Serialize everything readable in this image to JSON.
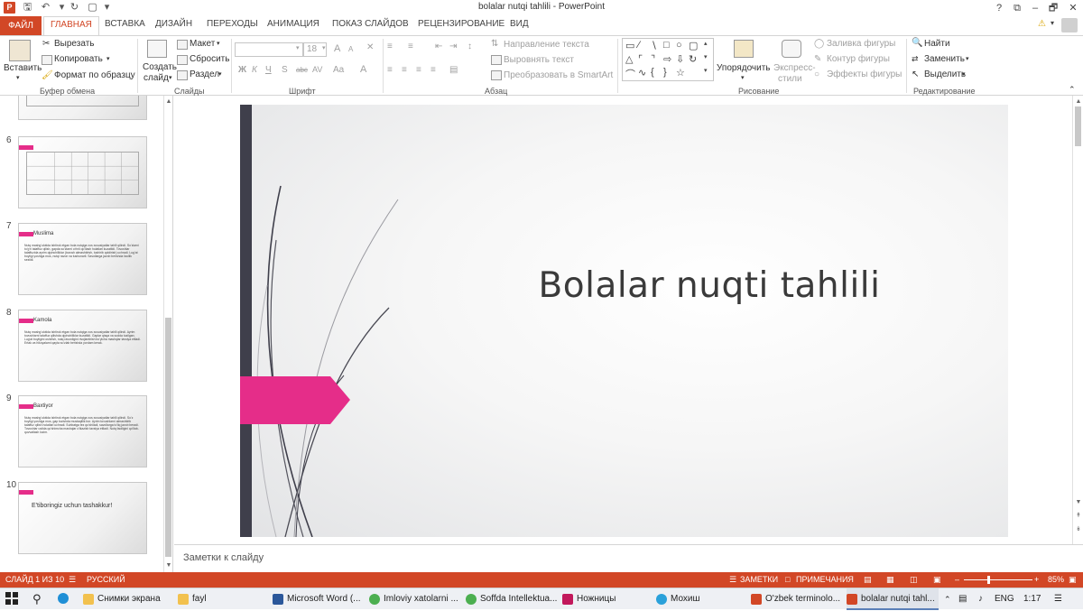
{
  "window": {
    "title": "bolalar nutqi tahlili - PowerPoint"
  },
  "titlebar": {
    "help": "?",
    "restore_ribbon": "⧉",
    "minimize": "–",
    "maximize": "🗗",
    "close": "✕"
  },
  "tabs": [
    "ФАЙЛ",
    "ГЛАВНАЯ",
    "ВСТАВКА",
    "ДИЗАЙН",
    "ПЕРЕХОДЫ",
    "АНИМАЦИЯ",
    "ПОКАЗ СЛАЙДОВ",
    "РЕЦЕНЗИРОВАНИЕ",
    "ВИД"
  ],
  "ribbon": {
    "clipboard": {
      "paste": "Вставить",
      "cut": "Вырезать",
      "copy": "Копировать",
      "format_painter": "Формат по образцу",
      "label": "Буфер обмена"
    },
    "slides": {
      "new_slide_line1": "Создать",
      "new_slide_line2": "слайд",
      "layout": "Макет",
      "reset": "Сбросить",
      "section": "Раздел",
      "label": "Слайды"
    },
    "font": {
      "font_name": "",
      "font_size": "18",
      "bold": "Ж",
      "italic": "К",
      "underline": "Ч",
      "shadow": "S",
      "strike": "abc",
      "spacing": "AV",
      "case": "Aa",
      "grow": "A",
      "shrink": "A",
      "label": "Шрифт"
    },
    "paragraph": {
      "text_direction": "Направление текста",
      "align_text": "Выровнять текст",
      "smartart": "Преобразовать в SmartArt",
      "label": "Абзац"
    },
    "drawing": {
      "arrange": "Упорядочить",
      "quick_styles_line1": "Экспресс-",
      "quick_styles_line2": "стили",
      "fill": "Заливка фигуры",
      "outline": "Контур фигуры",
      "effects": "Эффекты фигуры",
      "label": "Рисование"
    },
    "editing": {
      "find": "Найти",
      "replace": "Заменить",
      "select": "Выделить",
      "label": "Редактирование"
    }
  },
  "thumbnails": [
    {
      "number": "",
      "kind": "table"
    },
    {
      "number": "6",
      "kind": "table"
    },
    {
      "number": "7",
      "kind": "text",
      "title": "Muslima",
      "body": "Nutq mashg'ulotida ishtirok etgan bola nutqiga xos xususiyatlar tahlil qilindi. So'zlarni to'g'ri talaffuz qilish, gapda so'zlarni o'rinli qo'llash holatlari kuzatildi. Tovushlar talaffuzida ayrim qiyinchiliklar (tovush almashtirish, tushirib qoldirish) uchradi. Lug'at boyligi yoshiga mos, nutqi ravon va tushunarli. Savollarga javob berishda faollik sezildi."
    },
    {
      "number": "8",
      "kind": "text",
      "title": "Kamola",
      "body": "Nutq mashg'ulotida ishtirok etgan bola nutqiga xos xususiyatlar tahlil qilindi. Ayrim tovushlarni talaffuz qilishda qiyinchiliklar kuzatildi. Gaplar qisqa va sodda tuzilgan. Lug'at boyligini oshirish, nutq ravonligini rivojlantirish bo'yicha mashqlar tavsiya etiladi. Ertak va hikoyalarni qayta so'zlab berishda yordam kerak."
    },
    {
      "number": "9",
      "kind": "text",
      "title": "Baxtiyor",
      "body": "Nutq mashg'ulotida ishtirok etgan bola nutqiga xos xususiyatlar tahlil qilindi. So'z boyligi yoshiga mos, gap tuzishda mustaqillik bor. Ayrim tovushlarni almashtirib talaffuz qilish holatlari uchradi. Suhbatga tez qo'shiladi, savollarga to'liq javob beradi. Tovushlar ustida qo'shimcha mashqlar o'tkazish tavsiya etiladi. Nutq faolligini qo'llab-quvvatlash lozim."
    },
    {
      "number": "10",
      "kind": "end",
      "title": "E'tiboringiz uchun tashakkur!"
    }
  ],
  "slide": {
    "title": "Bolalar nuqti tahlili"
  },
  "notes": {
    "placeholder": "Заметки к слайду"
  },
  "status": {
    "slide": "СЛАЙД 1 ИЗ 10",
    "language": "РУССКИЙ",
    "notes": "ЗАМЕТКИ",
    "comments": "ПРИМЕЧАНИЯ",
    "zoom": "85%",
    "zoom_level": 0.36
  },
  "taskbar": {
    "items": [
      {
        "label": "Снимки экрана",
        "color": "#f2c14e"
      },
      {
        "label": "fayl",
        "color": "#f2c14e"
      },
      {
        "label": "Microsoft Word (...",
        "color": "#2b579a"
      },
      {
        "label": "Imloviy xatolarni ...",
        "color": "#4caf50"
      },
      {
        "label": "Soffda Intellektua...",
        "color": "#4caf50"
      },
      {
        "label": "Ножницы",
        "color": "#c2185b"
      },
      {
        "label": "Мохиш",
        "color": "#2aa1da"
      },
      {
        "label": "O'zbek terminolo...",
        "color": "#d24726"
      },
      {
        "label": "bolalar nutqi tahl...",
        "color": "#d24726"
      }
    ],
    "lang": "ENG",
    "time": "1:17"
  },
  "colors": {
    "accent": "#d24726",
    "slide_pink": "#e52d89",
    "slide_bar": "#3f3f4b"
  }
}
